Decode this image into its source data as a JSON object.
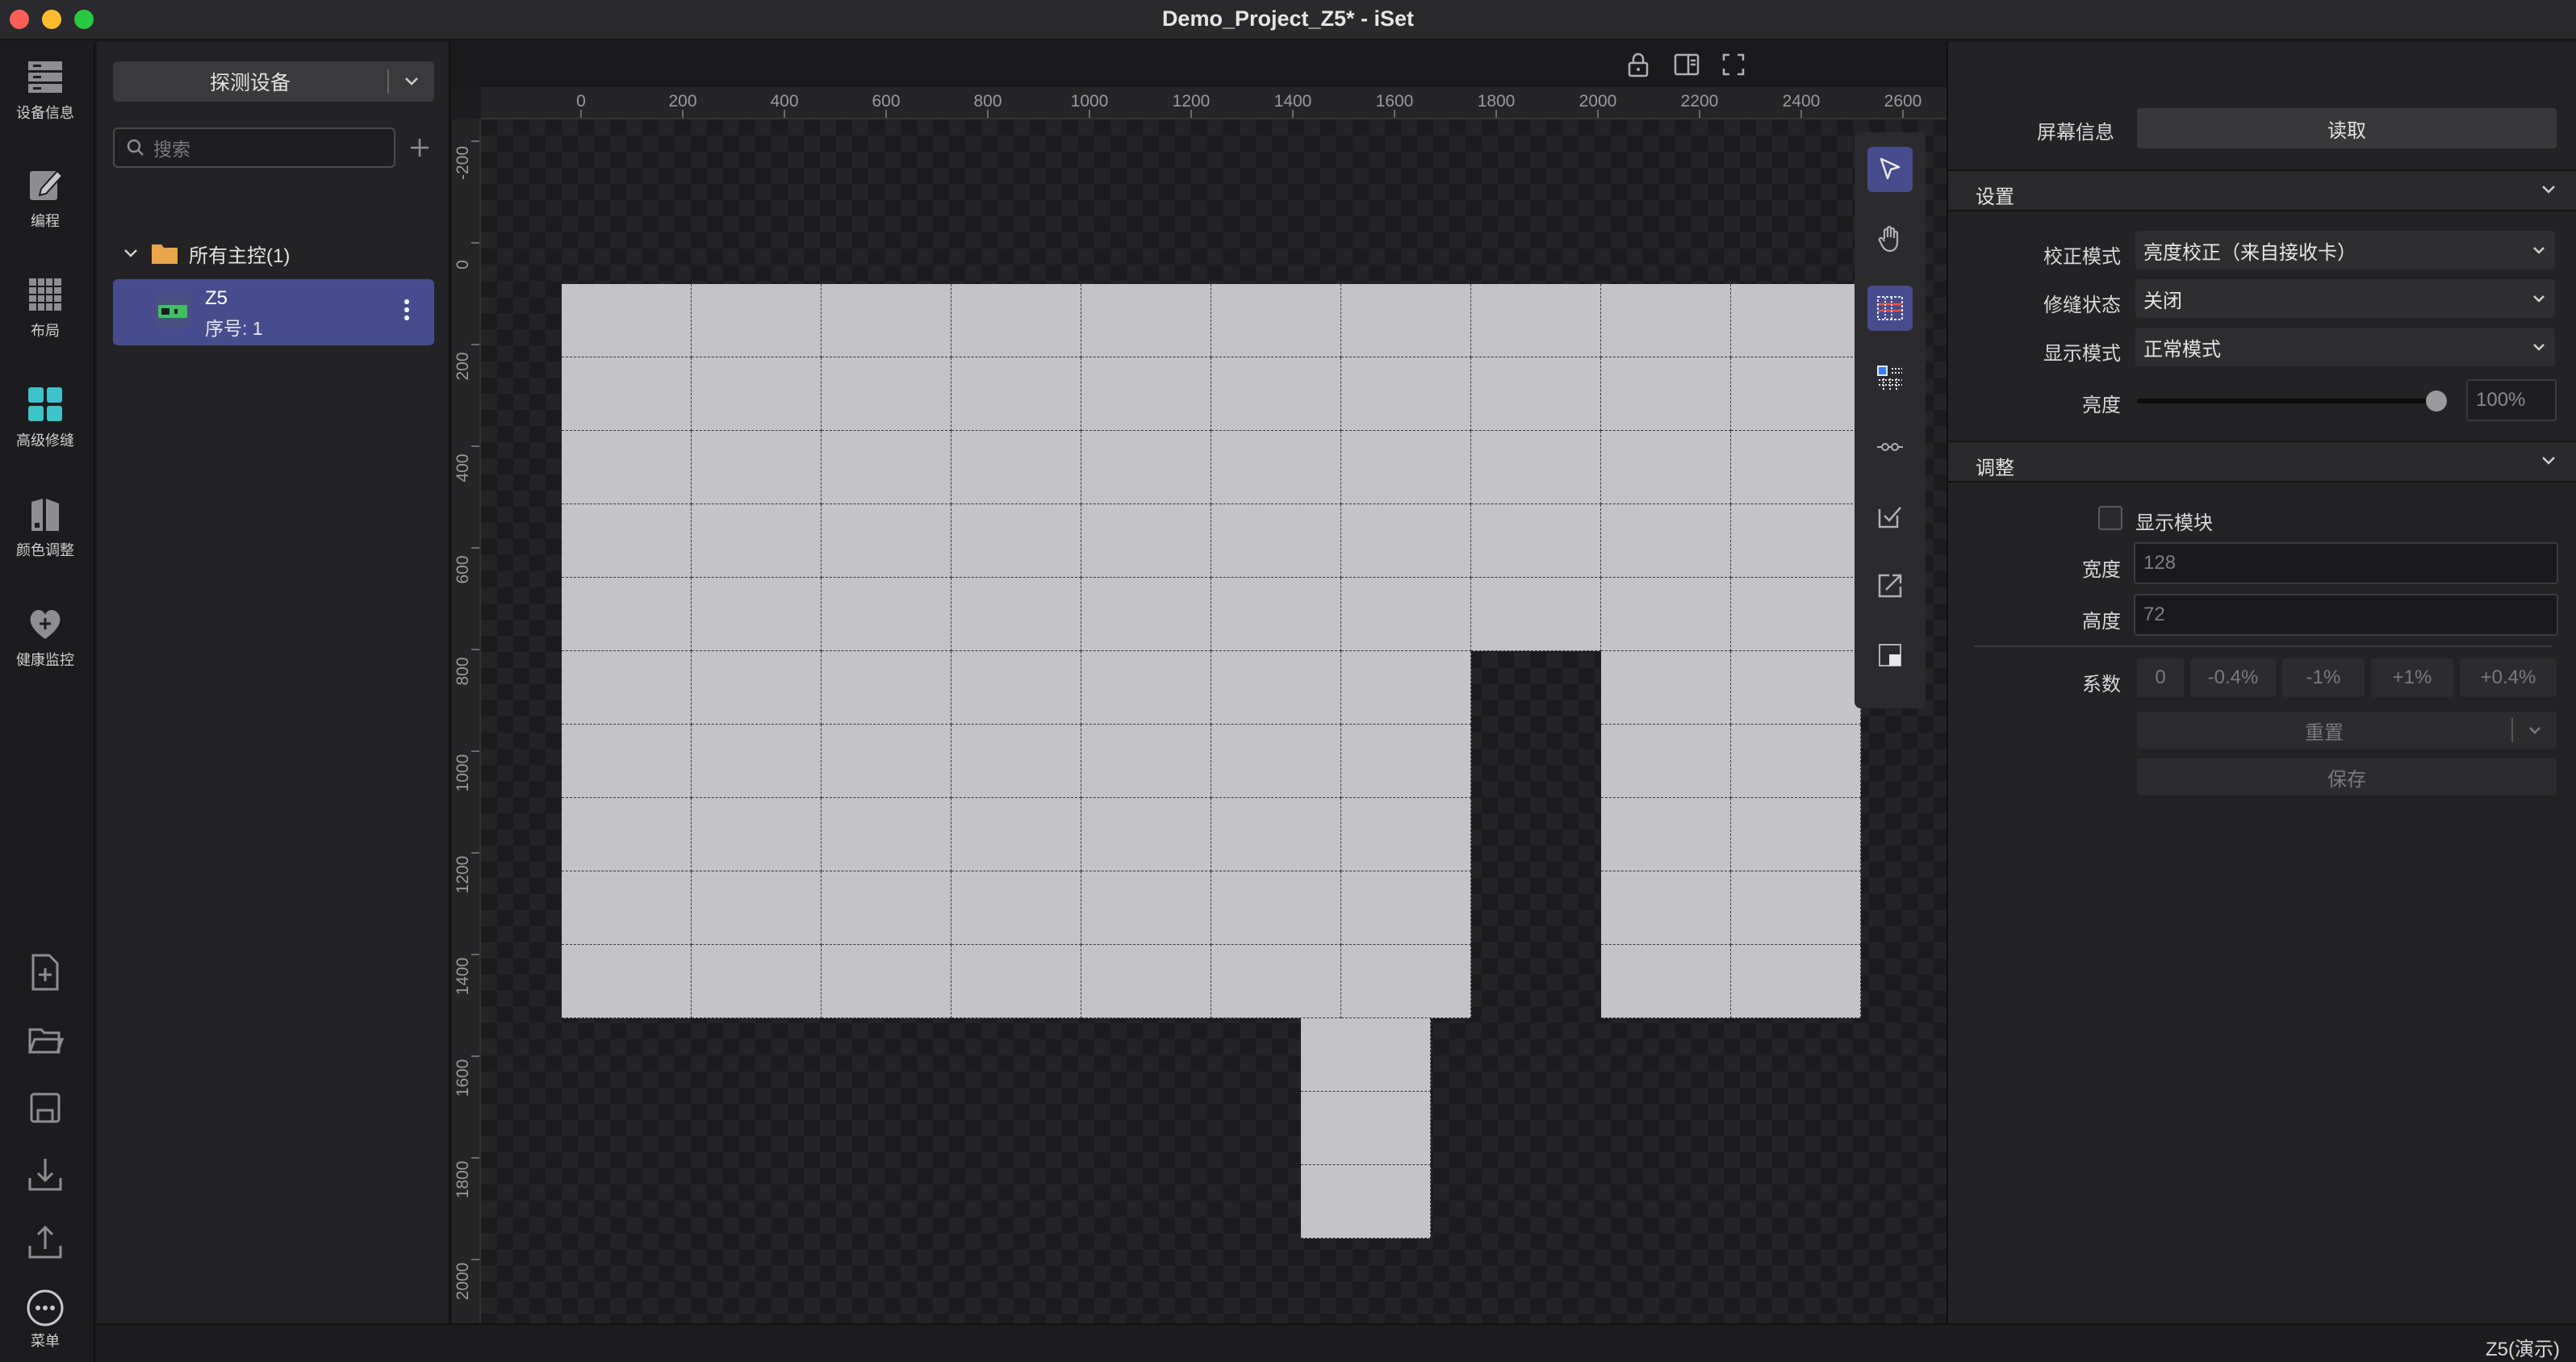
{
  "window": {
    "title": "Demo_Project_Z5* - iSet"
  },
  "leftbar": {
    "items": [
      {
        "label": "设备信息",
        "icon": "server-icon"
      },
      {
        "label": "编程",
        "icon": "edit-icon"
      },
      {
        "label": "布局",
        "icon": "grid-layout-icon"
      },
      {
        "label": "高级修缝",
        "icon": "tiles-icon"
      },
      {
        "label": "颜色调整",
        "icon": "color-adjust-icon"
      },
      {
        "label": "健康监控",
        "icon": "heart-plus-icon"
      }
    ],
    "bottom": [
      {
        "icon": "new-file-icon"
      },
      {
        "icon": "open-folder-icon"
      },
      {
        "icon": "save-icon"
      },
      {
        "icon": "import-icon"
      },
      {
        "icon": "export-icon"
      }
    ],
    "menu_label": "菜单"
  },
  "device_panel": {
    "detect_label": "探测设备",
    "search_placeholder": "搜索",
    "tree_root": "所有主控(1)",
    "device": {
      "name": "Z5",
      "seq": "序号: 1"
    }
  },
  "rulers": {
    "h": [
      "0",
      "200",
      "400",
      "600",
      "800",
      "1000",
      "1200",
      "1400",
      "1600",
      "1800",
      "2000",
      "2200",
      "2400",
      "2600"
    ],
    "v": [
      "-200",
      "0",
      "200",
      "400",
      "600",
      "800",
      "1000",
      "1200",
      "1400",
      "1600",
      "1800",
      "2000"
    ]
  },
  "right_panel": {
    "screen_info_label": "屏幕信息",
    "read_button": "读取",
    "settings_title": "设置",
    "calibration_label": "校正模式",
    "calibration_value": "亮度校正（来自接收卡）",
    "seam_label": "修缝状态",
    "seam_value": "关闭",
    "display_label": "显示模式",
    "display_value": "正常模式",
    "brightness_label": "亮度",
    "brightness_value": "100%",
    "brightness_level": 1.0,
    "adjust_title": "调整",
    "show_module_label": "显示模块",
    "width_label": "宽度",
    "width_value": "128",
    "height_label": "高度",
    "height_value": "72",
    "coef_label": "系数",
    "coefs": [
      "0",
      "-0.4%",
      "-1%",
      "+1%",
      "+0.4%"
    ],
    "reset_button": "重置",
    "save_button": "保存"
  },
  "status": {
    "text": "Z5(演示)"
  }
}
